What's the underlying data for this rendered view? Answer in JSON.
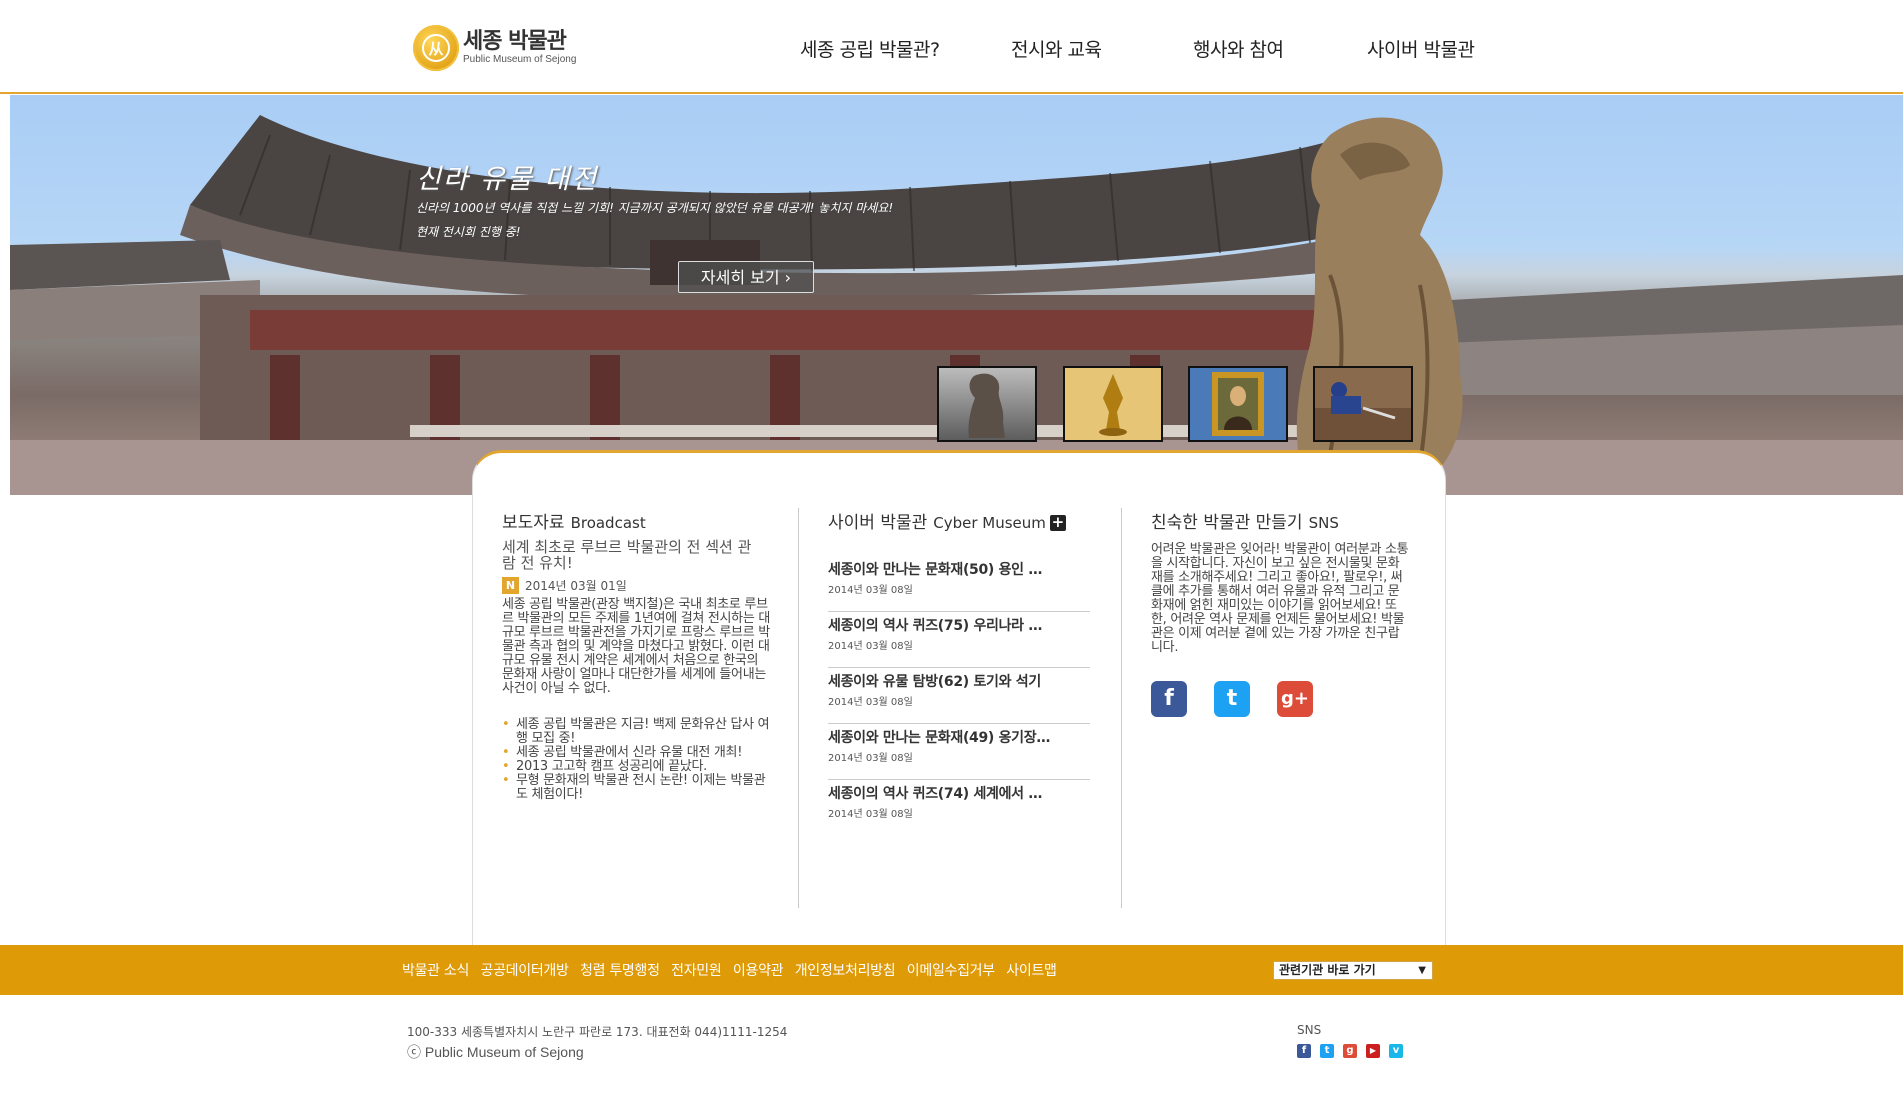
{
  "header": {
    "logo_ko": "세종 박물관",
    "logo_en": "Public Museum of Sejong",
    "nav": [
      "세종 공립 박물관?",
      "전시와 교육",
      "행사와 참여",
      "사이버 박물관"
    ]
  },
  "hero": {
    "title": "신라 유물 대전",
    "desc1": "신라의 1000년 역사를 직접 느낄 기회! 지금까지 공개되지 않았던 유물 대공개! 놓치지 마세요!",
    "desc2": "현재 전시회 진행 중!",
    "button": "자세히 보기 ›",
    "thumbnails": [
      "lion-statue",
      "gold-crown",
      "mona-lisa",
      "excavation"
    ]
  },
  "broadcast": {
    "title": "보도자료",
    "title_en": "Broadcast",
    "headline": "세계 최초로 루브르 박물관의 전 섹션 관람 전 유치!",
    "badge": "N",
    "date": "2014년 03월 01일",
    "body": "세종 공립 박물관(관장 백지철)은 국내 최초로 루브르 박물관의 모든 주제를 1년여에 걸쳐 전시하는 대규모 루브르 박물관전을 가지기로 프랑스 루브르 박물관 측과 협의 및 계약을 마쳤다고 밝혔다. 이런 대규모 유물 전시 계약은 세계에서 처음으로 한국의 문화재 사랑이 얼마나 대단한가를 세계에 들어내는 사건이 아닐 수 없다.",
    "bullets": [
      "세종 공립 박물관은 지금! 백제 문화유산 답사 여행 모집 중!",
      "세종 공립 박물관에서 신라 유물 대전 개최!",
      "2013 고고학 캠프 성공리에 끝났다.",
      "무형 문화재의 박물관 전시 논란! 이제는 박물관도 체험이다!"
    ]
  },
  "cyber": {
    "title": "사이버 박물관",
    "title_en": "Cyber Museum",
    "plus": "+",
    "items": [
      {
        "title": "세종이와 만나는 문화재(50) 용인 …",
        "date": "2014년 03월 08일"
      },
      {
        "title": "세종이의 역사 퀴즈(75) 우리나라 …",
        "date": "2014년 03월 08일"
      },
      {
        "title": "세종이와 유물 탐방(62) 토기와 석기",
        "date": "2014년 03월 08일"
      },
      {
        "title": "세종이와 만나는 문화재(49) 옹기장…",
        "date": "2014년 03월 08일"
      },
      {
        "title": "세종이의 역사 퀴즈(74) 세계에서 …",
        "date": "2014년 03월 08일"
      }
    ]
  },
  "sns_section": {
    "title": "친숙한 박물관 만들기",
    "title_en": "SNS",
    "text": "어려운 박물관은 잊어라! 박물관이 여러분과 소통을 시작합니다. 자신이 보고 싶은 전시물및 문화재를 소개해주세요! 그리고 좋아요!, 팔로우!, 써클에 추가를 통해서 여러 유물과 유적 그리고 문화재에 얽힌 재미있는 이야기를 읽어보세요! 또한, 어려운 역사 문제를 언제든 물어보세요! 박물관은 이제 여러분 곁에 있는 가장 가까운 친구랍니다.",
    "icons": [
      {
        "name": "facebook",
        "glyph": "f",
        "color": "#3b5998"
      },
      {
        "name": "twitter",
        "glyph": "t",
        "color": "#1da1f2"
      },
      {
        "name": "google-plus",
        "glyph": "g+",
        "color": "#dd4b39"
      }
    ]
  },
  "footer": {
    "links": [
      "박물관 소식",
      "공공데이터개방",
      "청렴 투명행정",
      "전자민원",
      "이용약관",
      "개인정보처리방침",
      "이메일수집거부",
      "사이트맵"
    ],
    "quick_select": "관련기관 바로 가기",
    "address": "100-333 세종특별자치시 노란구 파란로 173. 대표전화 044)1111-1254",
    "copyright": "ⓒ Public Museum of Sejong",
    "sns_label": "SNS",
    "sns_mini": [
      {
        "name": "facebook",
        "glyph": "f",
        "color": "#3b5998"
      },
      {
        "name": "twitter",
        "glyph": "t",
        "color": "#1da1f2"
      },
      {
        "name": "google-plus",
        "glyph": "g",
        "color": "#dd4b39"
      },
      {
        "name": "youtube",
        "glyph": "▶",
        "color": "#cc1f1f"
      },
      {
        "name": "vimeo",
        "glyph": "v",
        "color": "#1ab7ea"
      }
    ]
  },
  "colors": {
    "accent": "#e2a52e",
    "footer_bar": "#de9a07"
  }
}
